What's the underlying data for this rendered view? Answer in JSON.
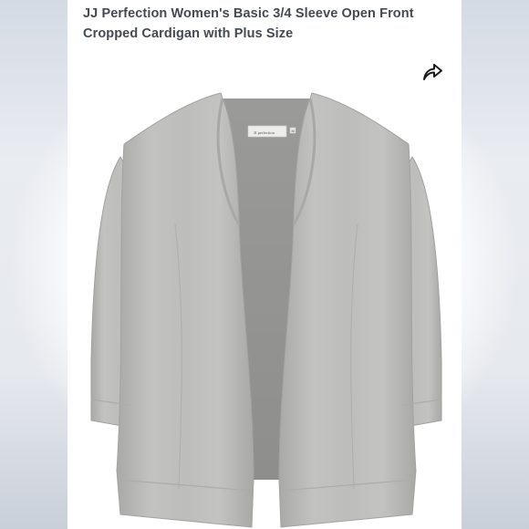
{
  "product": {
    "title_line1": "JJ Perfection Women's Basic 3/4 Sleeve Open Front",
    "title_line2": "Cropped Cardigan with Plus Size",
    "tag_text": "JJ perfection",
    "tag_size": "M",
    "garment_color": "#b9b9b7"
  },
  "actions": {
    "share_icon": "share-arrow-icon"
  }
}
